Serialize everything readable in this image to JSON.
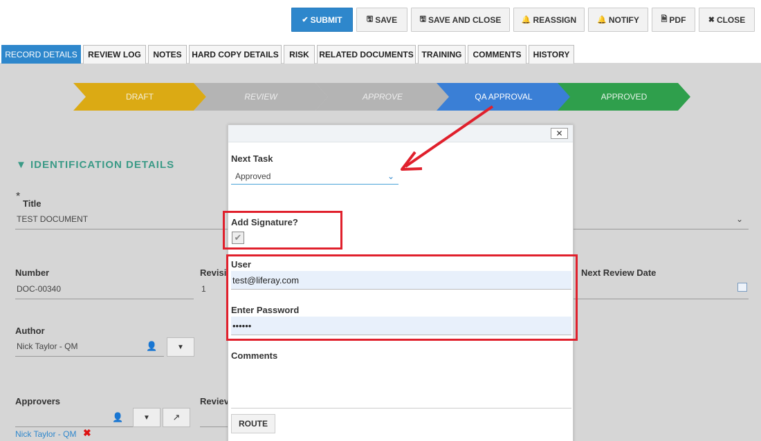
{
  "toolbar": {
    "submit": "SUBMIT",
    "save": "SAVE",
    "save_close": "SAVE AND CLOSE",
    "reassign": "REASSIGN",
    "notify": "NOTIFY",
    "pdf": "PDF",
    "close": "CLOSE"
  },
  "tabs": [
    "RECORD DETAILS",
    "REVIEW LOG",
    "NOTES",
    "HARD COPY DETAILS",
    "RISK",
    "RELATED DOCUMENTS",
    "TRAINING",
    "COMMENTS",
    "HISTORY"
  ],
  "workflow": [
    "DRAFT",
    "REVIEW",
    "APPROVE",
    "QA APPROVAL",
    "APPROVED"
  ],
  "section": {
    "title": "▼ IDENTIFICATION DETAILS",
    "required_mark": "*",
    "title_label": "Title",
    "title_value": "TEST DOCUMENT",
    "number_label": "Number",
    "number_value": "DOC-00340",
    "revision_label": "Revisi",
    "revision_value": "1",
    "next_review_label": "Next Review Date",
    "author_label": "Author",
    "author_value": "Nick Taylor - QM",
    "approvers_label": "Approvers",
    "approver_value": "Nick Taylor - QM",
    "reviewers_label": "Reviev"
  },
  "dialog": {
    "next_task_label": "Next Task",
    "next_task_value": "Approved",
    "add_signature_label": "Add Signature?",
    "user_label": "User",
    "user_value": "test@liferay.com",
    "password_label": "Enter Password",
    "password_value": "••••••",
    "comments_label": "Comments",
    "route_label": "ROUTE",
    "close_symbol": "✕"
  },
  "colors": {
    "primary": "#2e87cc",
    "draft": "#dbaa14",
    "inactive": "#b4b4b4",
    "current": "#3a7fd6",
    "approved": "#2f9f4c",
    "annotation": "#e0202c"
  }
}
